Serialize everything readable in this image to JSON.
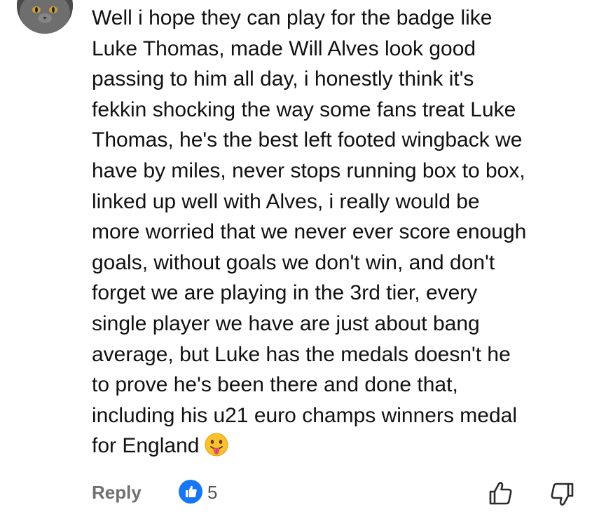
{
  "comment": {
    "avatar_icon": "cat-avatar-icon",
    "lines": [
      "Well i hope they can play for the badge like",
      "Luke Thomas, made Will Alves look good",
      "passing to him all day, i honestly think it's",
      "fekkin shocking the way some fans treat Luke",
      "Thomas, he's the best left footed wingback we",
      "have by miles, never stops running box to box,",
      "linked up well with Alves, i really would be",
      "more worried that we never ever score enough",
      "goals, without goals we don't win, and don't",
      "forget we are playing in the 3rd tier, every",
      "single player we have are just about bang",
      "average, but Luke has the medals doesn't he",
      "to prove he's been there and done that,",
      "including his u21 euro champs winners medal",
      "for England"
    ],
    "emoji": "face-with-tongue-emoji"
  },
  "actions": {
    "reply_label": "Reply",
    "like_count": "5",
    "like_badge_icon": "like-badge-icon",
    "like_button_icon": "thumbs-up-icon",
    "dislike_button_icon": "thumbs-down-icon"
  },
  "colors": {
    "like_blue": "#1876f2",
    "muted_text": "#707070",
    "body_text": "#111111",
    "emoji_yellow": "#fbc02d"
  }
}
